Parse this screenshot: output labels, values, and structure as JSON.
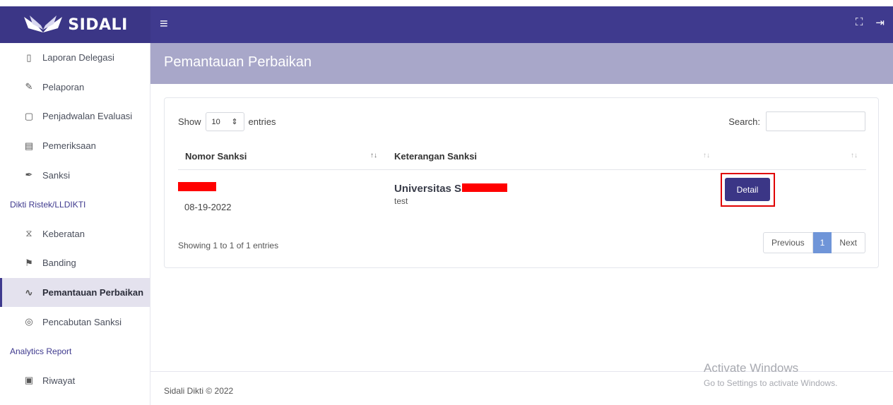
{
  "app": {
    "logo_text": "SIDALI"
  },
  "sidebar": {
    "items": [
      {
        "label": "Laporan Delegasi",
        "icon": "book-icon",
        "glyph": "▯"
      },
      {
        "label": "Pelaporan",
        "icon": "edit-icon",
        "glyph": "✎"
      },
      {
        "label": "Penjadwalan Evaluasi",
        "icon": "calendar-icon",
        "glyph": "▢"
      },
      {
        "label": "Pemeriksaan",
        "icon": "reader-icon",
        "glyph": "▤"
      },
      {
        "label": "Sanksi",
        "icon": "wrench-icon",
        "glyph": "✒"
      }
    ],
    "section1": "Dikti Ristek/LLDIKTI",
    "items2": [
      {
        "label": "Keberatan",
        "icon": "hourglass-icon",
        "glyph": "⧖"
      },
      {
        "label": "Banding",
        "icon": "signpost-icon",
        "glyph": "⚑"
      },
      {
        "label": "Pemantauan Perbaikan",
        "icon": "trend-icon",
        "glyph": "∿"
      },
      {
        "label": "Pencabutan Sanksi",
        "icon": "shield-icon",
        "glyph": "◎"
      }
    ],
    "section2": "Analytics Report",
    "items3": [
      {
        "label": "Riwayat",
        "icon": "history-icon",
        "glyph": "▣"
      }
    ]
  },
  "header": {
    "title": "Pemantauan Perbaikan"
  },
  "table": {
    "show_label": "Show",
    "entries_value": "10",
    "entries_label": "entries",
    "search_label": "Search:",
    "columns": [
      "Nomor Sanksi",
      "Keterangan Sanksi"
    ],
    "rows": [
      {
        "date": "08-19-2022",
        "university": "Universitas S",
        "keterangan": "test",
        "action": "Detail"
      }
    ],
    "info": "Showing 1 to 1 of 1 entries",
    "pagination": {
      "previous": "Previous",
      "current": "1",
      "next": "Next"
    }
  },
  "footer": {
    "text": "Sidali Dikti © 2022"
  },
  "watermark": {
    "line1": "Activate Windows",
    "line2": "Go to Settings to activate Windows."
  },
  "colors": {
    "topbar": "#3f3a8e",
    "header": "#a8a7c9",
    "button": "#3b3686",
    "page_active": "#6f95d8",
    "highlight": "#e00000"
  }
}
